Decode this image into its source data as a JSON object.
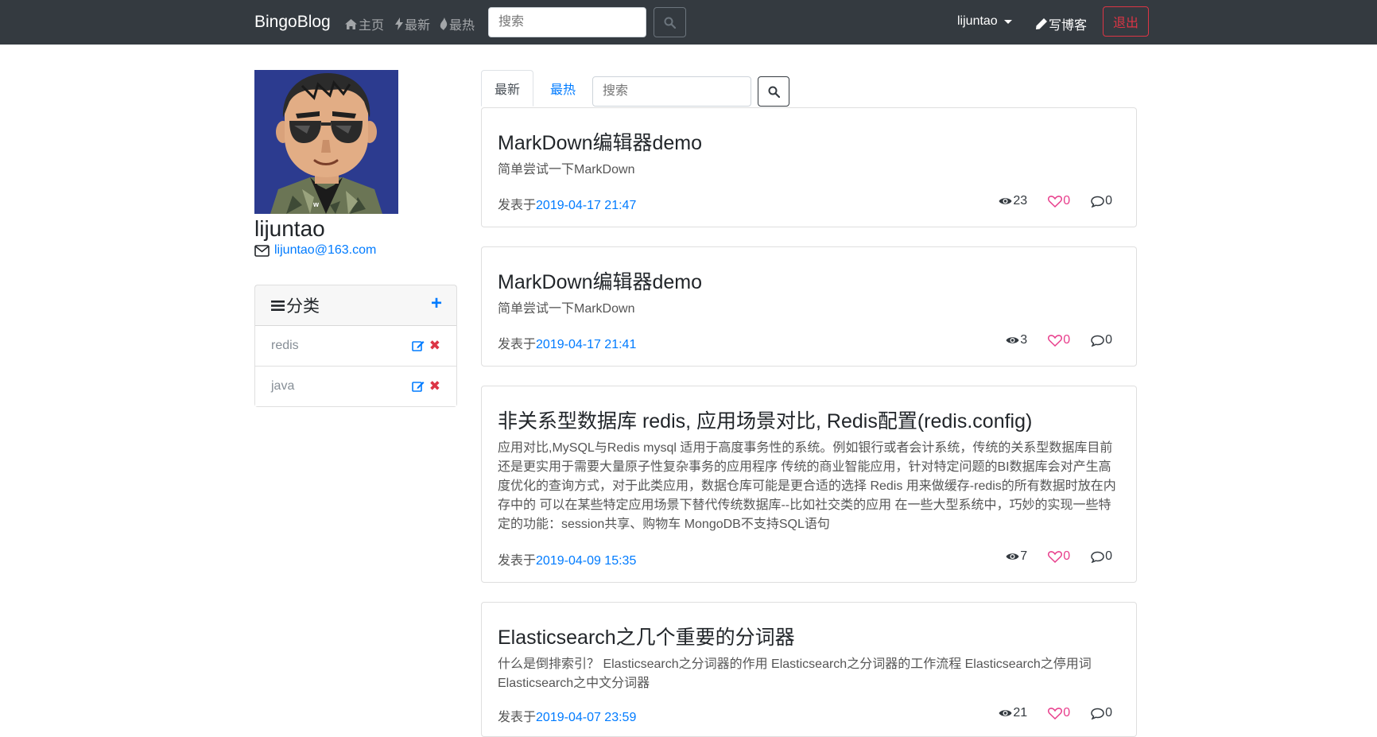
{
  "navbar": {
    "brand": "BingoBlog",
    "links": [
      {
        "label": "主页",
        "icon": "home-icon"
      },
      {
        "label": "最新",
        "icon": "bolt-icon"
      },
      {
        "label": "最热",
        "icon": "fire-icon"
      }
    ],
    "search_placeholder": "搜索",
    "user": "lijuntao",
    "write_label": "写博客",
    "logout_label": "退出"
  },
  "profile": {
    "name": "lijuntao",
    "email": "lijuntao@163.com"
  },
  "categories": {
    "title": "分类",
    "add_label": "+",
    "items": [
      {
        "label": "redis"
      },
      {
        "label": "java"
      }
    ]
  },
  "tabs": {
    "latest": "最新",
    "hot": "最热",
    "search_placeholder": "搜索"
  },
  "posts": [
    {
      "title": "MarkDown编辑器demo",
      "summary": "简单尝试一下MarkDown",
      "meta_prefix": "发表于",
      "date": "2019-04-17 21:47",
      "views": "23",
      "likes": "0",
      "comments": "0"
    },
    {
      "title": "MarkDown编辑器demo",
      "summary": "简单尝试一下MarkDown",
      "meta_prefix": "发表于",
      "date": "2019-04-17 21:41",
      "views": "3",
      "likes": "0",
      "comments": "0"
    },
    {
      "title": "非关系型数据库 redis, 应用场景对比, Redis配置(redis.config)",
      "summary": "应用对比,MySQL与Redis mysql 适用于高度事务性的系统。例如银行或者会计系统，传统的关系型数据库目前还是更实用于需要大量原子性复杂事务的应用程序 传统的商业智能应用，针对特定问题的BI数据库会对产生高度优化的查询方式，对于此类应用，数据仓库可能是更合适的选择 Redis 用来做缓存-redis的所有数据时放在内存中的 可以在某些特定应用场景下替代传统数据库--比如社交类的应用 在一些大型系统中，巧妙的实现一些特定的功能：session共享、购物车 MongoDB不支持SQL语句",
      "meta_prefix": "发表于",
      "date": "2019-04-09 15:35",
      "views": "7",
      "likes": "0",
      "comments": "0"
    },
    {
      "title": "Elasticsearch之几个重要的分词器",
      "summary": "什么是倒排索引？ Elasticsearch之分词器的作用 Elasticsearch之分词器的工作流程 Elasticsearch之停用词 Elasticsearch之中文分词器",
      "meta_prefix": "发表于",
      "date": "2019-04-07 23:59",
      "views": "21",
      "likes": "0",
      "comments": "0"
    }
  ]
}
